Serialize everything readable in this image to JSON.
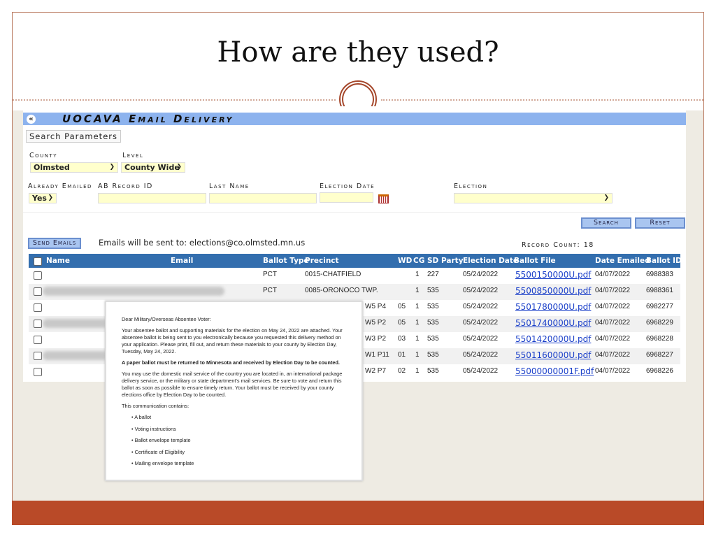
{
  "slide": {
    "title": "How are they used?"
  },
  "app": {
    "title": "UOCAVA Email Delivery",
    "search_parameters": "Search Parameters",
    "county_label": "County",
    "county_value": "Olmsted",
    "level_label": "Level",
    "level_value": "County Wide",
    "already_emailed_label": "Already Emailed",
    "already_emailed_value": "Yes",
    "ab_record_id_label": "AB Record ID",
    "last_name_label": "Last Name",
    "election_date_label": "Election Date",
    "election_label": "Election",
    "search_button": "Search",
    "reset_button": "Reset",
    "send_emails_button": "Send Emails",
    "emails_note": "Emails will be sent to: elections@co.olmsted.mn.us",
    "record_count": "Record Count: 18"
  },
  "table": {
    "headers": [
      "Name",
      "Email",
      "Ballot Type",
      "Precinct",
      "WD",
      "CG",
      "SD",
      "Party",
      "Election Date",
      "Ballot File",
      "Date Emailed",
      "Ballot ID"
    ],
    "rows": [
      {
        "type": "PCT",
        "precinct": "0015-CHATFIELD",
        "wd": "",
        "cg": "1",
        "sd": "227",
        "date": "05/24/2022",
        "file": "5500150000U.pdf",
        "emailed": "04/07/2022",
        "id": "6988383"
      },
      {
        "type": "PCT",
        "precinct": "0085-ORONOCO TWP.",
        "wd": "",
        "cg": "1",
        "sd": "535",
        "date": "05/24/2022",
        "file": "5500850000U.pdf",
        "emailed": "04/07/2022",
        "id": "6988361"
      },
      {
        "type": "",
        "precinct": "W5 P4",
        "wd": "05",
        "cg": "1",
        "sd": "535",
        "date": "05/24/2022",
        "file": "5501780000U.pdf",
        "emailed": "04/07/2022",
        "id": "6982277"
      },
      {
        "type": "",
        "precinct": "W5 P2",
        "wd": "05",
        "cg": "1",
        "sd": "535",
        "date": "05/24/2022",
        "file": "5501740000U.pdf",
        "emailed": "04/07/2022",
        "id": "6968229"
      },
      {
        "type": "",
        "precinct": "W3 P2",
        "wd": "03",
        "cg": "1",
        "sd": "535",
        "date": "05/24/2022",
        "file": "5501420000U.pdf",
        "emailed": "04/07/2022",
        "id": "6968228"
      },
      {
        "type": "",
        "precinct": "W1 P11",
        "wd": "01",
        "cg": "1",
        "sd": "535",
        "date": "05/24/2022",
        "file": "5501160000U.pdf",
        "emailed": "04/07/2022",
        "id": "6968227"
      },
      {
        "type": "",
        "precinct": "W2 P7",
        "wd": "02",
        "cg": "1",
        "sd": "535",
        "date": "05/24/2022",
        "file": "55000000001F.pdf",
        "emailed": "04/07/2022",
        "id": "6968226"
      }
    ]
  },
  "letter": {
    "greeting": "Dear Military/Overseas Absentee Voter:",
    "p1": "Your absentee ballot and supporting materials for the election on May 24, 2022 are attached. Your absentee ballot is being sent to you electronically because you requested this delivery method on your application. Please print, fill out, and return these materials to your county by Election Day, Tuesday, May 24, 2022.",
    "bold": "A paper ballot must be returned to Minnesota and received by Election Day to be counted.",
    "p2": "You may use the domestic mail service of the country you are located in, an international package delivery service, or the military or state department's mail services. Be sure to vote and return this ballot as soon as possible to ensure timely return.   Your ballot must be received by your county elections office by Election Day to be counted.",
    "contains": "This communication contains:",
    "items": [
      "A ballot",
      "Voting instructions",
      "Ballot envelope template",
      "Certificate of Eligibility",
      "Mailing envelope template"
    ]
  }
}
